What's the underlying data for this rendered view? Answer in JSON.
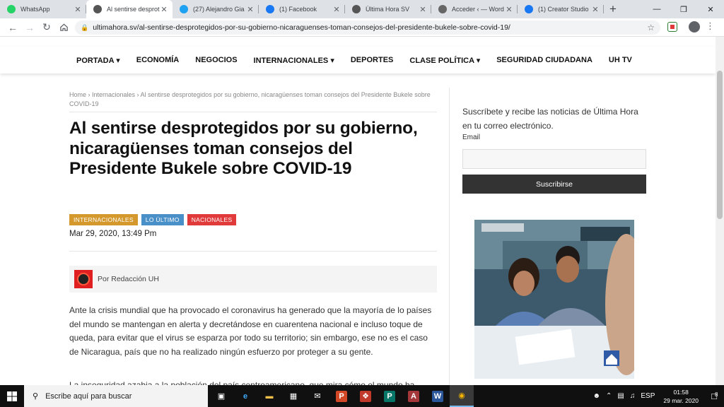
{
  "browser": {
    "tabs": [
      {
        "label": "WhatsApp",
        "icon": "whatsapp-icon",
        "color": "#25d366",
        "active": false
      },
      {
        "label": "Al sentirse desprot",
        "icon": "ultimahora-icon",
        "color": "#555555",
        "active": true
      },
      {
        "label": "(27) Alejandro Gia",
        "icon": "twitter-icon",
        "color": "#1da1f2",
        "active": false
      },
      {
        "label": "(1) Facebook",
        "icon": "facebook-icon",
        "color": "#1877f2",
        "active": false
      },
      {
        "label": "Última Hora SV",
        "icon": "ultimahora-icon",
        "color": "#555555",
        "active": false
      },
      {
        "label": "Acceder ‹ — Word",
        "icon": "wordpress-icon",
        "color": "#666666",
        "active": false
      },
      {
        "label": "(1) Creator Studio",
        "icon": "facebook-icon",
        "color": "#1877f2",
        "active": false
      }
    ],
    "newtab_glyph": "+",
    "url": "ultimahora.sv/al-sentirse-desprotegidos-por-su-gobierno-nicaraguenses-toman-consejos-del-presidente-bukele-sobre-covid-19/"
  },
  "site_nav": {
    "items": [
      "PORTADA ▾",
      "ECONOMÍA",
      "NEGOCIOS",
      "INTERNACIONALES ▾",
      "DEPORTES",
      "CLASE POLÍTICA ▾",
      "SEGURIDAD CIUDADANA",
      "UH TV"
    ]
  },
  "article": {
    "breadcrumb": "Home › Internacionales › Al sentirse desprotegidos por su gobierno, nicaragüenses toman consejos del Presidente Bukele sobre COVID-19",
    "title": "Al sentirse desprotegidos por su gobierno, nicaragüenses toman consejos del Presidente Bukele sobre COVID-19",
    "categories": [
      {
        "label": "INTERNACIONALES",
        "color": "#d4982c"
      },
      {
        "label": "LO ÚLTIMO",
        "color": "#4a90c8"
      },
      {
        "label": "NACIONALES",
        "color": "#e03a3a"
      }
    ],
    "date": "Mar 29, 2020, 13:49 Pm",
    "author": "Por Redacción UH",
    "body": "Ante la crisis mundial que ha provocado el coronavirus ha generado que la mayoría de lo países del mundo se mantengan en alerta y decretándose en cuarentena nacional e incluso toque de queda, para evitar que el virus se esparza por todo su territorio; sin embargo, ese no es el caso de Nicaragua, país que no ha realizado ningún esfuerzo por proteger a su gente.",
    "body_cut": "La inseguridad azabia a la población del país centroamericano, que mira cómo el mundo ha"
  },
  "sidebar": {
    "subscribe_text": "Suscríbete y recibe las noticias de Última Hora en tu correo electrónico.",
    "email_label": "Email",
    "email_value": "",
    "subscribe_button": "Suscribirse"
  },
  "taskbar": {
    "search_placeholder": "Escribe aquí para buscar",
    "apps": [
      "task-view-icon",
      "edge-icon",
      "file-explorer-icon",
      "store-icon",
      "mail-icon",
      "powerpoint-icon",
      "gift-icon",
      "publisher-icon",
      "access-icon",
      "word-icon",
      "chrome-icon"
    ],
    "language": "ESP",
    "time": "01:58",
    "date": "29 mar. 2020",
    "notifications": "8"
  }
}
